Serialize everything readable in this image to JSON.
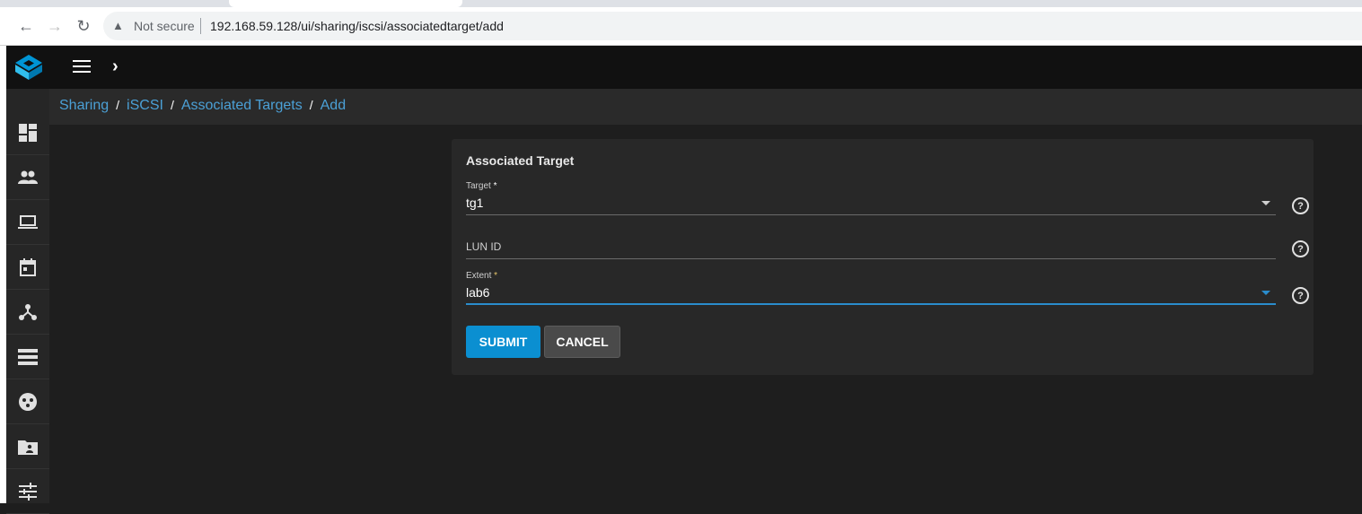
{
  "browser": {
    "security_label": "Not secure",
    "url": "192.168.59.128/ui/sharing/iscsi/associatedtarget/add"
  },
  "breadcrumb": [
    "Sharing",
    "iSCSI",
    "Associated Targets",
    "Add"
  ],
  "form": {
    "title": "Associated Target",
    "target": {
      "label": "Target",
      "required_mark": "*",
      "value": "tg1"
    },
    "lun": {
      "label": "LUN ID",
      "value": ""
    },
    "extent": {
      "label": "Extent",
      "required_mark": "*",
      "value": "lab6"
    },
    "submit_label": "SUBMIT",
    "cancel_label": "CANCEL"
  },
  "sidebar": [
    "dashboard-icon",
    "accounts-icon",
    "system-icon",
    "tasks-icon",
    "network-icon",
    "storage-icon",
    "directory-services-icon",
    "sharing-icon",
    "services-icon"
  ],
  "colors": {
    "accent": "#0b8fd1",
    "link": "#4ba0d6",
    "card": "#282828",
    "background": "#1e1e1e"
  }
}
